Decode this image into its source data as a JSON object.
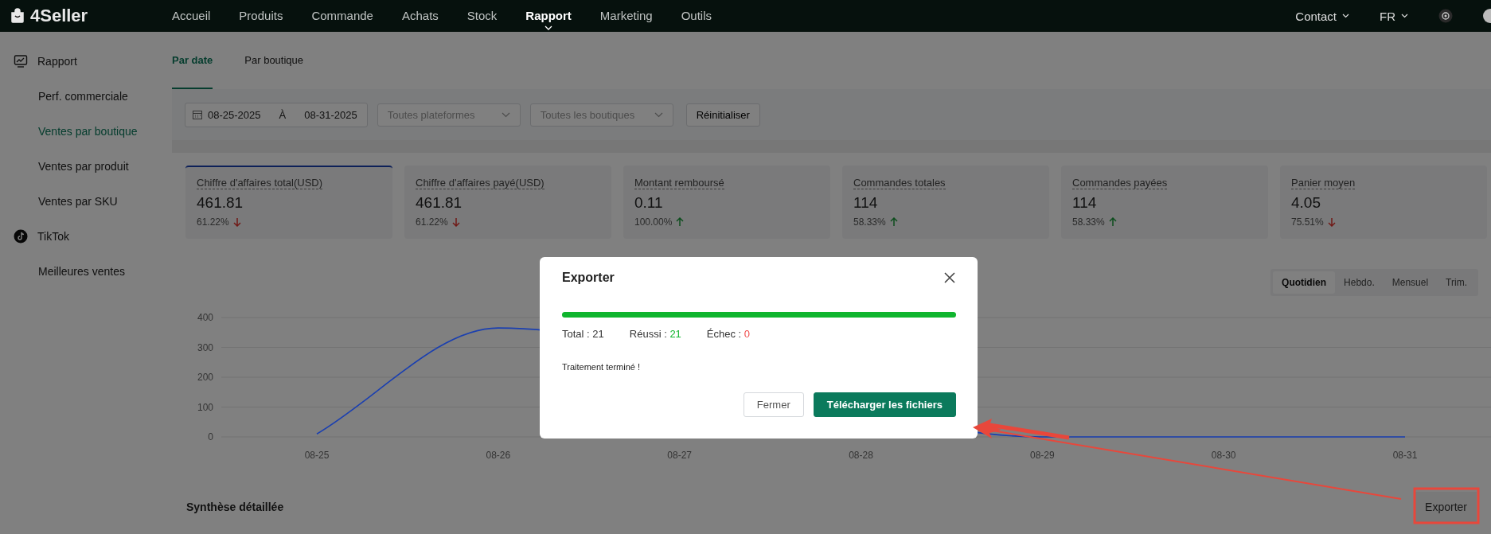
{
  "topbar": {
    "logo": "4Seller",
    "nav": [
      {
        "label": "Accueil",
        "selected": false
      },
      {
        "label": "Produits",
        "selected": false
      },
      {
        "label": "Commande",
        "selected": false
      },
      {
        "label": "Achats",
        "selected": false
      },
      {
        "label": "Stock",
        "selected": false
      },
      {
        "label": "Rapport",
        "selected": true
      },
      {
        "label": "Marketing",
        "selected": false
      },
      {
        "label": "Outils",
        "selected": false
      }
    ],
    "contact": "Contact",
    "language": "FR"
  },
  "sidebar": {
    "groups": [
      {
        "title": "Rapport",
        "kind": "report",
        "items": [
          {
            "label": "Perf. commerciale",
            "selected": false
          },
          {
            "label": "Ventes par boutique",
            "selected": true
          },
          {
            "label": "Ventes par produit",
            "selected": false
          },
          {
            "label": "Ventes par SKU",
            "selected": false
          }
        ]
      },
      {
        "title": "TikTok",
        "kind": "tiktok",
        "items": [
          {
            "label": "Meilleures ventes",
            "selected": false
          }
        ]
      }
    ]
  },
  "tabs": [
    {
      "label": "Par date",
      "selected": true
    },
    {
      "label": "Par boutique",
      "selected": false
    }
  ],
  "filters": {
    "date_from": "08-25-2025",
    "date_separator": "À",
    "date_to": "08-31-2025",
    "platform": {
      "placeholder": "Toutes plateformes"
    },
    "shop": {
      "placeholder": "Toutes les boutiques"
    },
    "reset": "Réinitialiser"
  },
  "kpis": [
    {
      "label": "Chiffre d'affaires total(USD)",
      "value": "461.81",
      "change": "61.22%",
      "rising": false,
      "selected": true
    },
    {
      "label": "Chiffre d'affaires payé(USD)",
      "value": "461.81",
      "change": "61.22%",
      "rising": false,
      "selected": false
    },
    {
      "label": "Montant remboursé",
      "value": "0.11",
      "change": "100.00%",
      "rising": true,
      "selected": false
    },
    {
      "label": "Commandes totales",
      "value": "114",
      "change": "58.33%",
      "rising": true,
      "selected": false
    },
    {
      "label": "Commandes payées",
      "value": "114",
      "change": "58.33%",
      "rising": true,
      "selected": false
    },
    {
      "label": "Panier moyen",
      "value": "4.05",
      "change": "75.51%",
      "rising": false,
      "selected": false
    }
  ],
  "periods": [
    {
      "label": "Quotidien",
      "selected": true
    },
    {
      "label": "Hebdo.",
      "selected": false
    },
    {
      "label": "Mensuel",
      "selected": false
    },
    {
      "label": "Trim.",
      "selected": false
    }
  ],
  "chart": {
    "chart_data": {
      "type": "line",
      "categories": [
        "08-25",
        "08-26",
        "08-27",
        "08-28",
        "08-29",
        "08-30",
        "08-31"
      ],
      "series": [
        {
          "color": "#1a3fb0",
          "values": [
            10,
            365,
            null,
            null,
            0,
            0,
            0
          ]
        }
      ],
      "ylim": [
        0,
        400
      ],
      "yticks": [
        0,
        100,
        200,
        300,
        400
      ],
      "grid": true
    }
  },
  "summary": {
    "title": "Synthèse détaillée",
    "export": "Exporter"
  },
  "modal": {
    "title": "Exporter",
    "level": 1,
    "stats": [
      {
        "label": "Total :",
        "value": "21",
        "kind": "neutral"
      },
      {
        "label": "Réussi :",
        "value": "21",
        "kind": "success"
      },
      {
        "label": "Échec :",
        "value": "0",
        "kind": "failure"
      }
    ],
    "message": "Traitement terminé !",
    "buttons": [
      {
        "label": "Fermer",
        "kind": "secondary"
      },
      {
        "label": "Télécharger les fichiers",
        "kind": "primary"
      }
    ]
  }
}
